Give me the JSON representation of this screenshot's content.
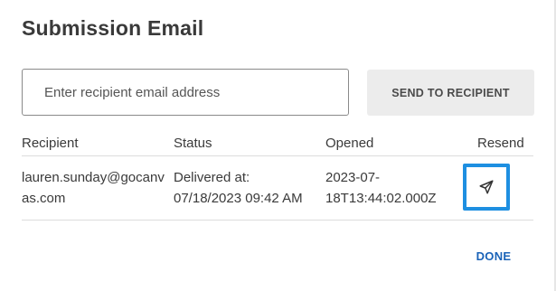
{
  "dialog": {
    "title": "Submission Email",
    "email_input": {
      "value": "",
      "placeholder": "Enter recipient email address"
    },
    "send_button_label": "SEND TO RECIPIENT",
    "done_button_label": "DONE"
  },
  "table": {
    "columns": [
      "Recipient",
      "Status",
      "Opened",
      "Resend"
    ],
    "rows": [
      {
        "recipient": "lauren.sunday@gocanvas.com",
        "status": "Delivered at: 07/18/2023 09:42 AM",
        "opened": "2023-07-18T13:44:02.000Z",
        "resend_icon": "send-icon"
      }
    ]
  },
  "colors": {
    "accent": "#1a63b8",
    "focus_ring": "#1e8fe1",
    "button_bg": "#ececec"
  }
}
